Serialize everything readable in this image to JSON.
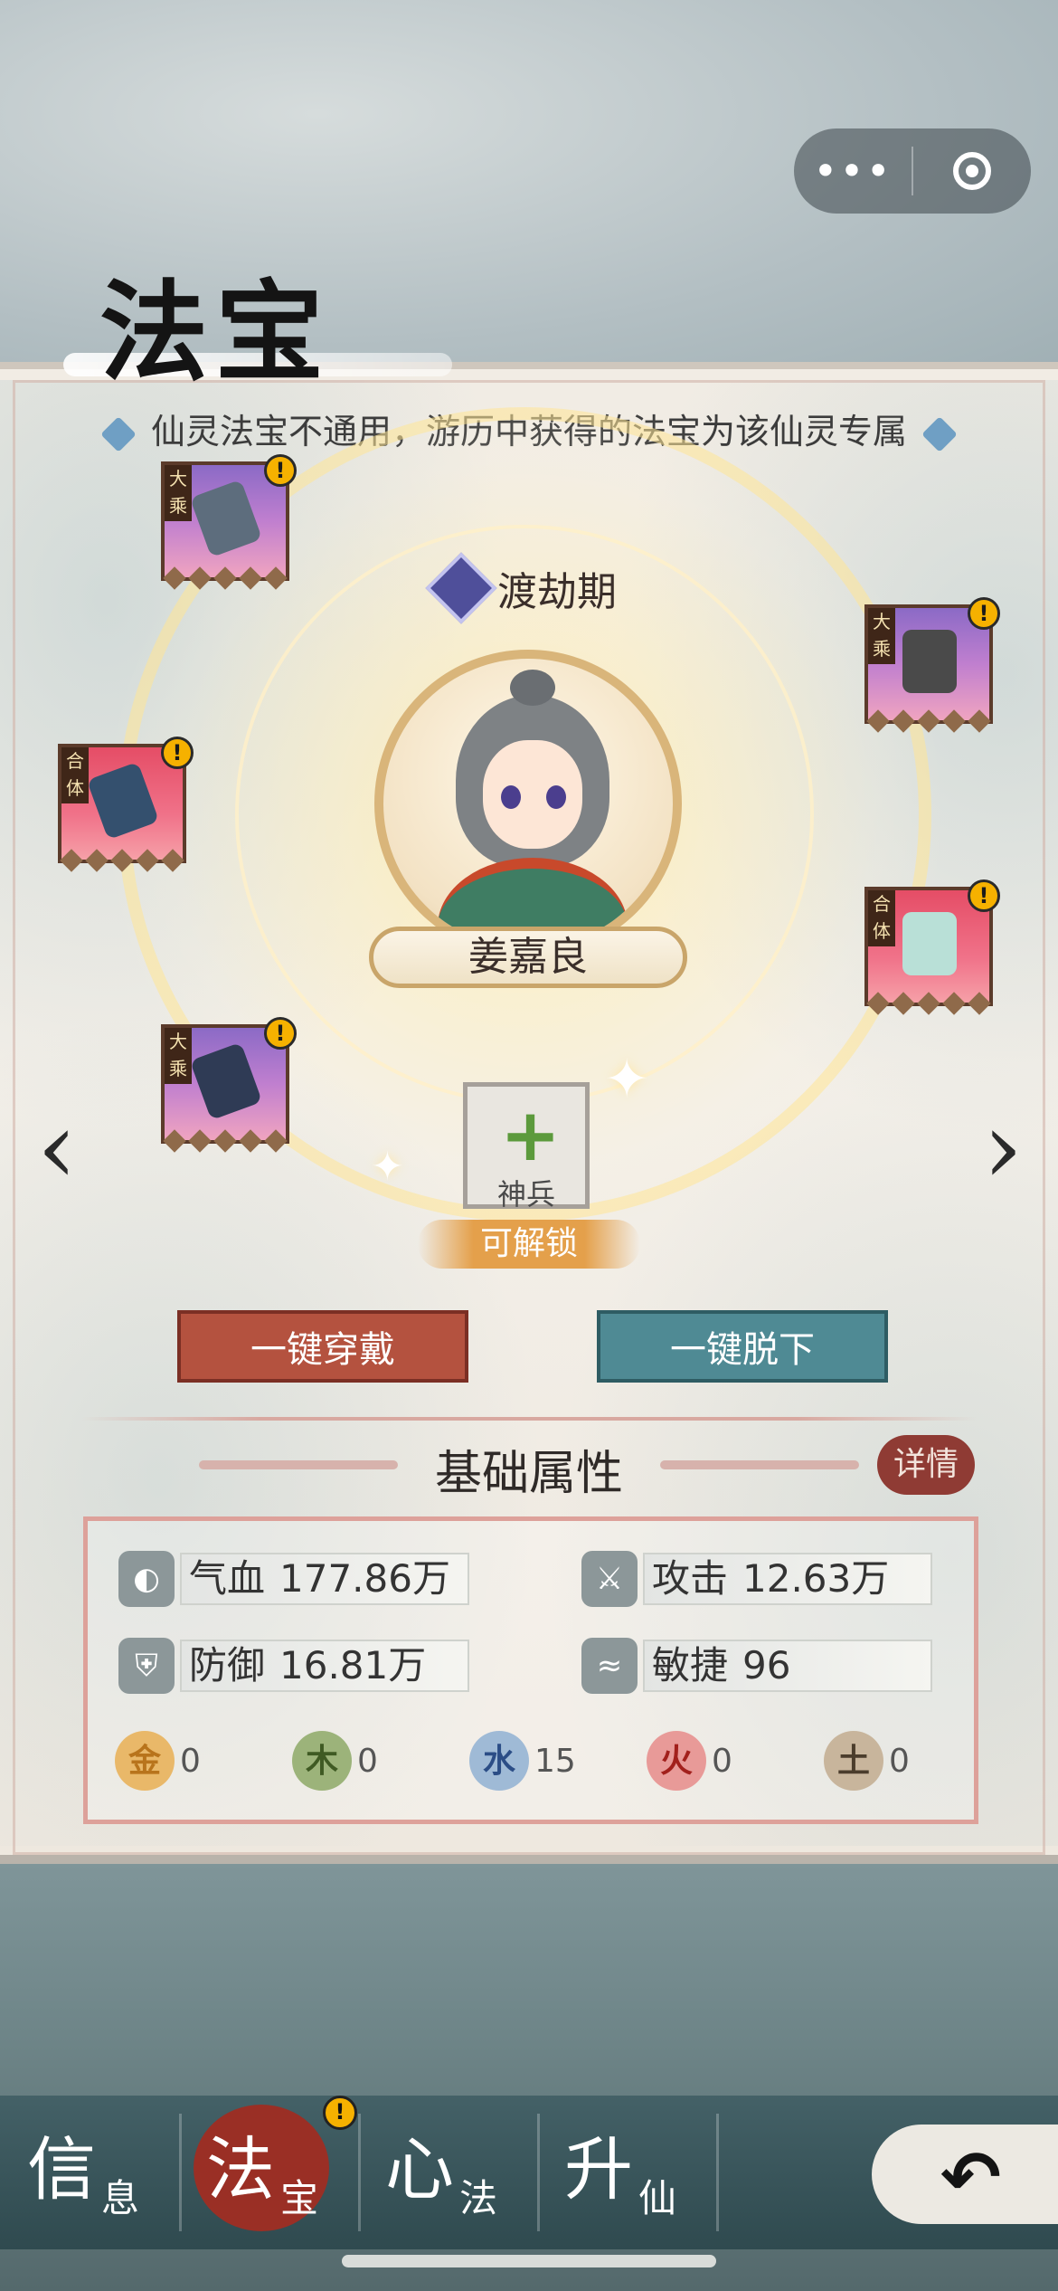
{
  "capsule": {
    "more_label": "•••"
  },
  "page_title": "法宝",
  "notice": "仙灵法宝不通用，游历中获得的法宝为该仙灵专属",
  "character": {
    "realm": "渡劫期",
    "name": "姜嘉良"
  },
  "slots": [
    {
      "tag": "大乘",
      "color": "purple",
      "alert": "!"
    },
    {
      "tag": "大乘",
      "color": "purple",
      "alert": "!"
    },
    {
      "tag": "合体",
      "color": "red",
      "alert": "!"
    },
    {
      "tag": "合体",
      "color": "red",
      "alert": "!"
    },
    {
      "tag": "大乘",
      "color": "purple",
      "alert": "!"
    }
  ],
  "locked_slot": {
    "icon": "+",
    "label": "神兵",
    "status": "可解锁"
  },
  "nav": {
    "prev": "‹",
    "next": "›"
  },
  "buttons": {
    "equip_all": "一键穿戴",
    "unequip_all": "一键脱下"
  },
  "attributes": {
    "title": "基础属性",
    "detail": "详情",
    "stats": [
      {
        "label": "气血",
        "value": "177.86万",
        "icon": "blood-drop-icon"
      },
      {
        "label": "攻击",
        "value": "12.63万",
        "icon": "attack-icon"
      },
      {
        "label": "防御",
        "value": "16.81万",
        "icon": "shield-icon"
      },
      {
        "label": "敏捷",
        "value": "96",
        "icon": "wing-icon"
      }
    ],
    "elements": [
      {
        "char": "金",
        "value": "0",
        "color": "#e9b869",
        "text_color": "#b8741c"
      },
      {
        "char": "木",
        "value": "0",
        "color": "#9cb37a",
        "text_color": "#3f5a23"
      },
      {
        "char": "水",
        "value": "15",
        "color": "#9fbad6",
        "text_color": "#2b4d86"
      },
      {
        "char": "火",
        "value": "0",
        "color": "#e89a98",
        "text_color": "#a2201c"
      },
      {
        "char": "土",
        "value": "0",
        "color": "#c8b59c",
        "text_color": "#4b3d2c"
      }
    ]
  },
  "tabs": [
    {
      "big": "信",
      "small": "息"
    },
    {
      "big": "法",
      "small": "宝",
      "alert": "!"
    },
    {
      "big": "心",
      "small": "法"
    },
    {
      "big": "升",
      "small": "仙"
    }
  ],
  "back_icon": "↶"
}
